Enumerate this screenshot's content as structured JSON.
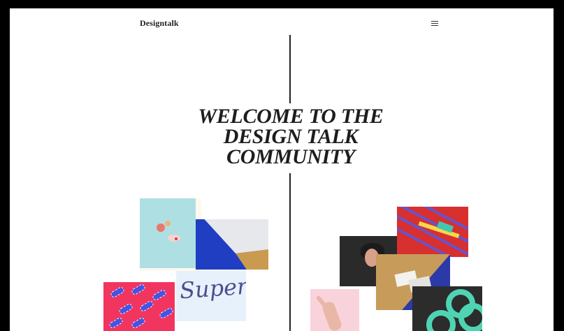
{
  "header": {
    "logo": "Designtalk",
    "menu_icon": "hamburger-menu-icon"
  },
  "hero": {
    "headline_lines": [
      "WELCOME TO THE",
      "DESIGN TALK",
      "COMMUNITY"
    ]
  },
  "collage": {
    "tile_text": "Super"
  },
  "colors": {
    "page_background": "#ffffff",
    "frame": "#000000",
    "text": "#1d1d1d",
    "divider": "#222222"
  }
}
